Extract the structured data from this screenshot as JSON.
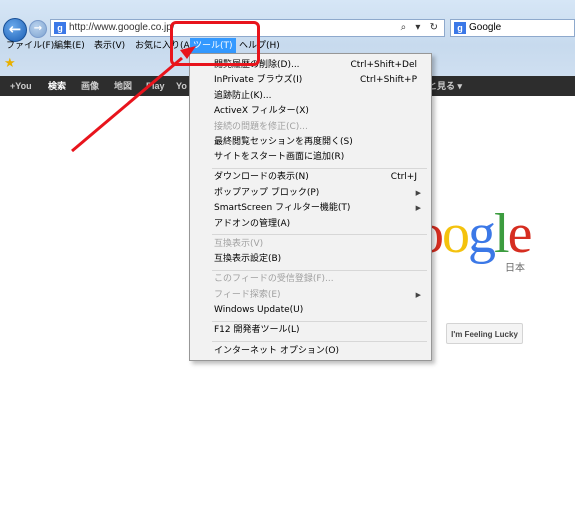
{
  "browser": {
    "address_url": "http://www.google.co.jp/",
    "address_tools": "⌕ ▾ ↻",
    "tab_title": "Google"
  },
  "menubar": {
    "items": [
      {
        "label": "ファイル(F)"
      },
      {
        "label": "編集(E)"
      },
      {
        "label": "表示(V)"
      },
      {
        "label": "お気に入り(A)"
      },
      {
        "label": "ツール(T)"
      },
      {
        "label": "ヘルプ(H)"
      }
    ]
  },
  "google_bar": {
    "items": [
      {
        "label": "+You"
      },
      {
        "label": "検索"
      },
      {
        "label": "画像"
      },
      {
        "label": "地図"
      },
      {
        "label": "Play"
      },
      {
        "label": "Yo"
      },
      {
        "label": "もっと見る ▾"
      }
    ]
  },
  "tools_menu": {
    "items": [
      {
        "label": "閲覧履歴の削除(D)...",
        "shortcut": "Ctrl+Shift+Del"
      },
      {
        "label": "InPrivate ブラウズ(I)",
        "shortcut": "Ctrl+Shift+P"
      },
      {
        "label": "追跡防止(K)..."
      },
      {
        "label": "ActiveX フィルター(X)"
      },
      {
        "label": "接続の問題を修正(C)..."
      },
      {
        "label": "最終閲覧セッションを再度開く(S)"
      },
      {
        "label": "サイトをスタート画面に追加(R)"
      },
      {
        "label": "ダウンロードの表示(N)",
        "shortcut": "Ctrl+J"
      },
      {
        "label": "ポップアップ ブロック(P)",
        "arrow": "▶"
      },
      {
        "label": "SmartScreen フィルター機能(T)",
        "arrow": "▶"
      },
      {
        "label": "アドオンの管理(A)"
      },
      {
        "label": "互換表示(V)"
      },
      {
        "label": "互換表示設定(B)"
      },
      {
        "label": "このフィードの受信登録(F)..."
      },
      {
        "label": "フィード探索(E)",
        "arrow": "▶"
      },
      {
        "label": "Windows Update(U)"
      },
      {
        "label": "F12 開発者ツール(L)"
      },
      {
        "label": "インターネット オプション(O)"
      }
    ]
  },
  "google_page": {
    "logo_letters": [
      "o",
      "o",
      "g",
      "l",
      "e"
    ],
    "logo_sub": "日本",
    "lucky_button": "I'm Feeling Lucky"
  },
  "colors": {
    "annotation_red": "#e8141c",
    "menu_highlight": "#3399ff",
    "google_bar": "#2d2d2d"
  }
}
